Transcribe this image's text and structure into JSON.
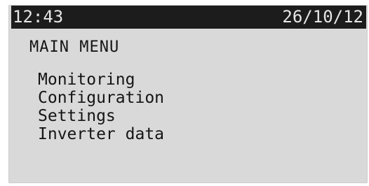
{
  "status_bar": {
    "time": "12:43",
    "date": "26/10/12"
  },
  "menu": {
    "title": "MAIN MENU",
    "items": [
      {
        "label": "Monitoring"
      },
      {
        "label": "Configuration"
      },
      {
        "label": "Settings"
      },
      {
        "label": "Inverter data"
      }
    ]
  },
  "colors": {
    "lcd_background": "#d9d9d9",
    "status_bar_background": "#1c1c1c",
    "status_bar_text": "#e6e6e6",
    "text": "#151515"
  }
}
